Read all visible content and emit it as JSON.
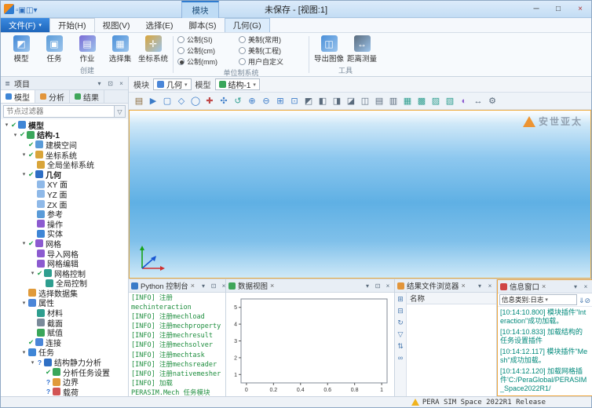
{
  "window": {
    "title": "未保存 - [视图:1]",
    "contextual_tab": "模块",
    "minimize": "─",
    "maximize": "□",
    "close": "×"
  },
  "quick_access": [
    {
      "name": "new-file-icon",
      "glyph": "▫"
    },
    {
      "name": "open-file-icon",
      "glyph": "▣"
    },
    {
      "name": "save-icon",
      "glyph": "◫"
    },
    {
      "name": "quick-access-more-icon",
      "glyph": "▾"
    }
  ],
  "menu": {
    "file_label": "文件(F)",
    "tabs": [
      {
        "name": "start",
        "label": "开始(H)",
        "active": true
      },
      {
        "name": "view",
        "label": "视图(V)"
      },
      {
        "name": "select",
        "label": "选择(E)"
      },
      {
        "name": "script",
        "label": "脚本(S)"
      },
      {
        "name": "geometry",
        "label": "几何(G)",
        "contextual": true
      }
    ]
  },
  "ribbon": {
    "create": {
      "label": "创建",
      "items": [
        {
          "name": "model",
          "label": "模型",
          "glyph": "◩",
          "color": "#3f86d6"
        },
        {
          "name": "task",
          "label": "任务",
          "glyph": "▣",
          "color": "#5a9bd8"
        },
        {
          "name": "job",
          "label": "作业",
          "glyph": "▤",
          "color": "#7c6cd6"
        },
        {
          "name": "selection-set",
          "label": "选择集",
          "glyph": "▦",
          "color": "#4a90d9"
        },
        {
          "name": "coordinate-system",
          "label": "坐标系统",
          "glyph": "✛",
          "color": "#d9a53a"
        }
      ]
    },
    "units": {
      "label": "单位制系统",
      "options": [
        {
          "name": "unit-si",
          "label": "公制(SI)"
        },
        {
          "name": "unit-us-common",
          "label": "美制(常用)"
        },
        {
          "name": "unit-cm",
          "label": "公制(cm)"
        },
        {
          "name": "unit-us-eng",
          "label": "美制(工程)"
        },
        {
          "name": "unit-mm",
          "label": "公制(mm)",
          "selected": true
        },
        {
          "name": "unit-custom",
          "label": "用户自定义"
        }
      ]
    },
    "tools": {
      "label": "工具",
      "items": [
        {
          "name": "export-image",
          "label": "导出图像",
          "glyph": "◫",
          "color": "#4a90d9"
        },
        {
          "name": "distance-measure",
          "label": "距离测量",
          "glyph": "↔",
          "color": "#5a6b7c"
        }
      ]
    }
  },
  "project": {
    "title": "项目",
    "tabs": [
      {
        "name": "model",
        "label": "模型",
        "color": "#3f86d6",
        "active": true
      },
      {
        "name": "analysis",
        "label": "分析",
        "color": "#e2953a"
      },
      {
        "name": "results",
        "label": "结果",
        "color": "#3fa65a"
      }
    ],
    "filter_placeholder": "节点过滤器",
    "tree": [
      {
        "d": 0,
        "e": "v",
        "s": "c",
        "icon": "model",
        "label": "模型",
        "b": true
      },
      {
        "d": 1,
        "e": "v",
        "s": "c",
        "icon": "structure",
        "label": "结构-1",
        "b": true
      },
      {
        "d": 2,
        "e": "",
        "s": "c",
        "icon": "space",
        "label": "建模空间"
      },
      {
        "d": 2,
        "e": "v",
        "s": "c",
        "icon": "coords",
        "label": "坐标系统"
      },
      {
        "d": 3,
        "e": "",
        "s": "",
        "icon": "coords",
        "label": "全局坐标系统"
      },
      {
        "d": 2,
        "e": "v",
        "s": "c",
        "icon": "geometry",
        "label": "几何",
        "b": true
      },
      {
        "d": 3,
        "e": "",
        "s": "",
        "icon": "plane",
        "label": "XY 面"
      },
      {
        "d": 3,
        "e": "",
        "s": "",
        "icon": "plane",
        "label": "YZ 面"
      },
      {
        "d": 3,
        "e": "",
        "s": "",
        "icon": "plane",
        "label": "ZX 面"
      },
      {
        "d": 3,
        "e": "",
        "s": "",
        "icon": "reference",
        "label": "参考"
      },
      {
        "d": 3,
        "e": "",
        "s": "",
        "icon": "operation",
        "label": "操作"
      },
      {
        "d": 3,
        "e": "",
        "s": "",
        "icon": "solid",
        "label": "实体"
      },
      {
        "d": 2,
        "e": "v",
        "s": "c",
        "icon": "mesh",
        "label": "网格"
      },
      {
        "d": 3,
        "e": "",
        "s": "",
        "icon": "mesh-import",
        "label": "导入网格"
      },
      {
        "d": 3,
        "e": "",
        "s": "",
        "icon": "mesh-edit",
        "label": "网格编辑"
      },
      {
        "d": 3,
        "e": "v",
        "s": "c",
        "icon": "mesh-control",
        "label": "网格控制"
      },
      {
        "d": 4,
        "e": "",
        "s": "",
        "icon": "global-control",
        "label": "全局控制"
      },
      {
        "d": 2,
        "e": "",
        "s": "",
        "icon": "dataset",
        "label": "选择数据集"
      },
      {
        "d": 2,
        "e": "v",
        "s": "",
        "icon": "property",
        "label": "属性"
      },
      {
        "d": 3,
        "e": "",
        "s": "",
        "icon": "material",
        "label": "材料"
      },
      {
        "d": 3,
        "e": "",
        "s": "",
        "icon": "section",
        "label": "截面"
      },
      {
        "d": 3,
        "e": "",
        "s": "",
        "icon": "assign",
        "label": "赋值"
      },
      {
        "d": 2,
        "e": "",
        "s": "c",
        "icon": "connection",
        "label": "连接"
      },
      {
        "d": 2,
        "e": "v",
        "s": "",
        "icon": "task",
        "label": "任务"
      },
      {
        "d": 3,
        "e": "v",
        "s": "q",
        "icon": "analysis",
        "label": "结构静力分析"
      },
      {
        "d": 4,
        "e": "",
        "s": "c",
        "icon": "settings",
        "label": "分析任务设置"
      },
      {
        "d": 4,
        "e": "",
        "s": "q",
        "icon": "boundary",
        "label": "边界"
      },
      {
        "d": 4,
        "e": "",
        "s": "q",
        "icon": "load",
        "label": "载荷"
      }
    ]
  },
  "icon_colors": {
    "model": "#3f86d6",
    "structure": "#3aa65a",
    "space": "#5a9bd8",
    "coords": "#d9a53a",
    "geometry": "#2f6fc4",
    "plane": "#8fb9e8",
    "reference": "#5a9bd8",
    "operation": "#8c5bd0",
    "solid": "#3f86d6",
    "mesh": "#8c5bd0",
    "mesh-import": "#8c5bd0",
    "mesh-edit": "#8c5bd0",
    "mesh-control": "#2e9e8f",
    "global-control": "#2e9e8f",
    "dataset": "#e09a3a",
    "property": "#4a86d8",
    "material": "#2e9e8f",
    "section": "#7a8a9a",
    "assign": "#3aa65a",
    "connection": "#4a86d8",
    "task": "#3f86d6",
    "analysis": "#2f6fc4",
    "settings": "#3aa65a",
    "boundary": "#e09a3a",
    "load": "#d25454"
  },
  "vp": {
    "module_label": "模块",
    "module_value": "几何",
    "model_label": "模型",
    "model_value": "结构-1"
  },
  "vp_icons": [
    {
      "n": "print-icon",
      "g": "▤",
      "c": "#8a6b3c"
    },
    {
      "n": "select-icon",
      "g": "▶",
      "c": "#3a7bc8"
    },
    {
      "n": "box-select-icon",
      "g": "▢",
      "c": "#3a7bc8"
    },
    {
      "n": "polygon-select-icon",
      "g": "◇",
      "c": "#3a7bc8"
    },
    {
      "n": "circle-select-icon",
      "g": "◯",
      "c": "#3a7bc8"
    },
    {
      "n": "pick-point-icon",
      "g": "✚",
      "c": "#c04848"
    },
    {
      "n": "pan-icon",
      "g": "✣",
      "c": "#3a7bc8"
    },
    {
      "n": "rotate-view-icon",
      "g": "↺",
      "c": "#2e9e8f"
    },
    {
      "n": "zoom-in-icon",
      "g": "⊕",
      "c": "#3a7bc8"
    },
    {
      "n": "zoom-out-icon",
      "g": "⊖",
      "c": "#3a7bc8"
    },
    {
      "n": "zoom-window-icon",
      "g": "⊞",
      "c": "#3a7bc8"
    },
    {
      "n": "fit-view-icon",
      "g": "⊡",
      "c": "#3a7bc8"
    },
    {
      "n": "iso-view-icon",
      "g": "◩",
      "c": "#5a6b7c"
    },
    {
      "n": "front-view-icon",
      "g": "◧",
      "c": "#5a6b7c"
    },
    {
      "n": "back-view-icon",
      "g": "◨",
      "c": "#5a6b7c"
    },
    {
      "n": "left-view-icon",
      "g": "◪",
      "c": "#5a6b7c"
    },
    {
      "n": "right-view-icon",
      "g": "◫",
      "c": "#5a6b7c"
    },
    {
      "n": "top-view-icon",
      "g": "▤",
      "c": "#5a6b7c"
    },
    {
      "n": "bottom-view-icon",
      "g": "▥",
      "c": "#5a6b7c"
    },
    {
      "n": "wireframe-icon",
      "g": "▦",
      "c": "#2e9e8f"
    },
    {
      "n": "shaded-icon",
      "g": "▩",
      "c": "#2e9e8f"
    },
    {
      "n": "edges-icon",
      "g": "▨",
      "c": "#2e9e8f"
    },
    {
      "n": "mesh-display-icon",
      "g": "▧",
      "c": "#2e9e8f"
    },
    {
      "n": "section-view-icon",
      "g": "◐",
      "c": "#8c5bd0"
    },
    {
      "n": "measure-icon",
      "g": "↔",
      "c": "#5a6b7c"
    },
    {
      "n": "display-settings-icon",
      "g": "⚙",
      "c": "#5a6b7c"
    }
  ],
  "viewport": {
    "watermark": "安世亚太"
  },
  "console_panel": {
    "title": "Python 控制台",
    "lines": [
      "[INFO] 注册",
      "mechinteraction",
      "[INFO] 注册mechload",
      "[INFO] 注册mechproperty",
      "[INFO] 注册mechresult",
      "[INFO] 注册mechsolver",
      "[INFO] 注册mechtask",
      "[INFO] 注册mechsreader",
      "[INFO] 注册nativemesher",
      "[INFO] 加载",
      "PERASIM.Mech 任务模块"
    ]
  },
  "data_view_panel": {
    "title": "数据视图"
  },
  "chart_data": {
    "type": "scatter",
    "title": "",
    "xlabel": "",
    "ylabel": "",
    "x": [],
    "y": [],
    "xlim": [
      -0.04,
      1.04
    ],
    "ylim": [
      0.5,
      5.5
    ],
    "x_ticks": [
      0,
      0.2,
      0.4,
      0.6,
      0.8,
      1
    ],
    "y_ticks": [
      1,
      2,
      3,
      4,
      5
    ],
    "grid": false,
    "legend": "none",
    "note": "empty plot, no data series plotted"
  },
  "results_panel": {
    "title": "结果文件浏览器",
    "column": "名称",
    "strip_icons": [
      {
        "name": "expand-all-icon",
        "glyph": "⊞"
      },
      {
        "name": "collapse-all-icon",
        "glyph": "⊟"
      },
      {
        "name": "refresh-icon",
        "glyph": "↻"
      },
      {
        "name": "filter-icon",
        "glyph": "▽"
      },
      {
        "name": "sort-icon",
        "glyph": "⇅"
      },
      {
        "name": "link-icon",
        "glyph": "∞"
      }
    ]
  },
  "info_panel": {
    "title": "信息窗口",
    "category_label": "信息类别:日志",
    "icons": [
      {
        "name": "export-log-icon",
        "glyph": "⇓"
      },
      {
        "name": "clear-log-icon",
        "glyph": "⊘"
      }
    ],
    "messages": [
      "[10:14:10.800] 模块插件\"Interaction\"成功加载。",
      "[10:14:10.833] 加载结构的任务设置插件",
      "[10:14:12.117] 模块插件\"Mesh\"成功加载。",
      "[10:14:12.120] 加载网格插件'C:/PeraGlobal/PERASIM_Space2022R1/"
    ]
  },
  "status": {
    "product": "PERA SIM Space 2022R1 Release"
  }
}
